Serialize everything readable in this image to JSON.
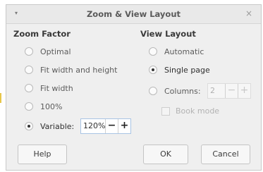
{
  "dialog": {
    "title": "Zoom & View Layout",
    "menu_glyph": "▾",
    "close_glyph": "×"
  },
  "zoom_factor": {
    "heading": "Zoom Factor",
    "options": [
      {
        "label": "Optimal",
        "checked": false
      },
      {
        "label": "Fit width and height",
        "checked": false
      },
      {
        "label": "Fit width",
        "checked": false
      },
      {
        "label": "100%",
        "checked": false
      },
      {
        "label": "Variable:",
        "checked": true
      }
    ],
    "variable_value": "120%",
    "minus": "−",
    "plus": "+"
  },
  "view_layout": {
    "heading": "View Layout",
    "options": [
      {
        "label": "Automatic",
        "checked": false
      },
      {
        "label": "Single page",
        "checked": true
      },
      {
        "label": "Columns:",
        "checked": false
      }
    ],
    "columns_value": "2",
    "minus": "−",
    "plus": "+",
    "book_mode_label": "Book mode",
    "book_mode_checked": false
  },
  "buttons": {
    "help": "Help",
    "ok": "OK",
    "cancel": "Cancel"
  },
  "colors": {
    "spin_focus_border": "#a9c4e4",
    "accent_bar": "#e7c64a"
  }
}
